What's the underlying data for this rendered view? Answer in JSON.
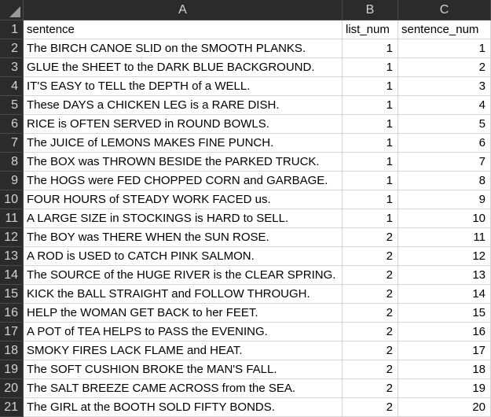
{
  "columns": [
    "A",
    "B",
    "C"
  ],
  "header_cells": [
    "sentence",
    "list_num",
    "sentence_num"
  ],
  "rows": [
    {
      "num": "2",
      "sentence": "The BIRCH CANOE SLID on the SMOOTH PLANKS.",
      "list_num": "1",
      "sentence_num": "1"
    },
    {
      "num": "3",
      "sentence": "GLUE the SHEET to the DARK BLUE BACKGROUND.",
      "list_num": "1",
      "sentence_num": "2"
    },
    {
      "num": "4",
      "sentence": "IT'S EASY to TELL the DEPTH of a WELL.",
      "list_num": "1",
      "sentence_num": "3"
    },
    {
      "num": "5",
      "sentence": "These DAYS a CHICKEN LEG is a RARE DISH.",
      "list_num": "1",
      "sentence_num": "4"
    },
    {
      "num": "6",
      "sentence": "RICE is OFTEN SERVED in ROUND BOWLS.",
      "list_num": "1",
      "sentence_num": "5"
    },
    {
      "num": "7",
      "sentence": "The JUICE of LEMONS MAKES FINE PUNCH.",
      "list_num": "1",
      "sentence_num": "6"
    },
    {
      "num": "8",
      "sentence": "The BOX was THROWN BESIDE the PARKED TRUCK.",
      "list_num": "1",
      "sentence_num": "7"
    },
    {
      "num": "9",
      "sentence": "The HOGS were FED CHOPPED CORN and GARBAGE.",
      "list_num": "1",
      "sentence_num": "8"
    },
    {
      "num": "10",
      "sentence": "FOUR HOURS of STEADY WORK FACED us.",
      "list_num": "1",
      "sentence_num": "9"
    },
    {
      "num": "11",
      "sentence": "A LARGE SIZE in STOCKINGS is HARD to SELL.",
      "list_num": "1",
      "sentence_num": "10"
    },
    {
      "num": "12",
      "sentence": "The BOY was THERE WHEN the SUN ROSE.",
      "list_num": "2",
      "sentence_num": "11"
    },
    {
      "num": "13",
      "sentence": "A ROD is USED to CATCH PINK SALMON.",
      "list_num": "2",
      "sentence_num": "12"
    },
    {
      "num": "14",
      "sentence": "The SOURCE of the HUGE RIVER is the CLEAR SPRING.",
      "list_num": "2",
      "sentence_num": "13"
    },
    {
      "num": "15",
      "sentence": "KICK the BALL STRAIGHT and FOLLOW THROUGH.",
      "list_num": "2",
      "sentence_num": "14"
    },
    {
      "num": "16",
      "sentence": "HELP the WOMAN GET BACK to her FEET.",
      "list_num": "2",
      "sentence_num": "15"
    },
    {
      "num": "17",
      "sentence": "A POT of TEA HELPS to PASS the EVENING.",
      "list_num": "2",
      "sentence_num": "16"
    },
    {
      "num": "18",
      "sentence": "SMOKY FIRES LACK FLAME and HEAT.",
      "list_num": "2",
      "sentence_num": "17"
    },
    {
      "num": "19",
      "sentence": "The SOFT CUSHION BROKE the MAN'S FALL.",
      "list_num": "2",
      "sentence_num": "18"
    },
    {
      "num": "20",
      "sentence": "The SALT BREEZE CAME ACROSS from the SEA.",
      "list_num": "2",
      "sentence_num": "19"
    },
    {
      "num": "21",
      "sentence": "The GIRL at the BOOTH SOLD FIFTY BONDS.",
      "list_num": "2",
      "sentence_num": "20"
    }
  ]
}
